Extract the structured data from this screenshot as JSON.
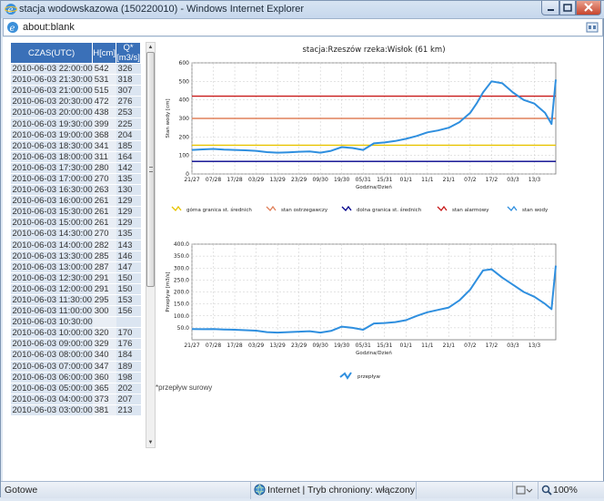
{
  "window": {
    "title": "stacja wodowskazowa (150220010) - Windows Internet Explorer"
  },
  "address": {
    "url": "about:blank"
  },
  "table": {
    "headers": [
      "CZAS(UTC)",
      "H[cm]",
      "Q*[m3/s]"
    ],
    "rows": [
      [
        "2010-06-03 22:00:00",
        "542",
        "326"
      ],
      [
        "2010-06-03 21:30:00",
        "531",
        "318"
      ],
      [
        "2010-06-03 21:00:00",
        "515",
        "307"
      ],
      [
        "2010-06-03 20:30:00",
        "472",
        "276"
      ],
      [
        "2010-06-03 20:00:00",
        "438",
        "253"
      ],
      [
        "2010-06-03 19:30:00",
        "399",
        "225"
      ],
      [
        "2010-06-03 19:00:00",
        "368",
        "204"
      ],
      [
        "2010-06-03 18:30:00",
        "341",
        "185"
      ],
      [
        "2010-06-03 18:00:00",
        "311",
        "164"
      ],
      [
        "2010-06-03 17:30:00",
        "280",
        "142"
      ],
      [
        "2010-06-03 17:00:00",
        "270",
        "135"
      ],
      [
        "2010-06-03 16:30:00",
        "263",
        "130"
      ],
      [
        "2010-06-03 16:00:00",
        "261",
        "129"
      ],
      [
        "2010-06-03 15:30:00",
        "261",
        "129"
      ],
      [
        "2010-06-03 15:00:00",
        "261",
        "129"
      ],
      [
        "2010-06-03 14:30:00",
        "270",
        "135"
      ],
      [
        "2010-06-03 14:00:00",
        "282",
        "143"
      ],
      [
        "2010-06-03 13:30:00",
        "285",
        "146"
      ],
      [
        "2010-06-03 13:00:00",
        "287",
        "147"
      ],
      [
        "2010-06-03 12:30:00",
        "291",
        "150"
      ],
      [
        "2010-06-03 12:00:00",
        "291",
        "150"
      ],
      [
        "2010-06-03 11:30:00",
        "295",
        "153"
      ],
      [
        "2010-06-03 11:00:00",
        "300",
        "156"
      ],
      [
        "2010-06-03 10:30:00",
        "",
        ""
      ],
      [
        "2010-06-03 10:00:00",
        "320",
        "170"
      ],
      [
        "2010-06-03 09:00:00",
        "329",
        "176"
      ],
      [
        "2010-06-03 08:00:00",
        "340",
        "184"
      ],
      [
        "2010-06-03 07:00:00",
        "347",
        "189"
      ],
      [
        "2010-06-03 06:00:00",
        "360",
        "198"
      ],
      [
        "2010-06-03 05:00:00",
        "365",
        "202"
      ],
      [
        "2010-06-03 04:00:00",
        "373",
        "207"
      ],
      [
        "2010-06-03 03:00:00",
        "381",
        "213"
      ]
    ]
  },
  "note": "*przepływ surowy",
  "status": {
    "text": "Gotowe",
    "zone": "Internet | Tryb chroniony: włączony",
    "zoom": "100%"
  },
  "colors": {
    "accent": "#3a70b8",
    "series": "#2f8fdf",
    "upper": "#e8c400",
    "warning": "#e0805a",
    "lower": "#00008b",
    "alarm": "#c81a1a"
  },
  "chart_data": [
    {
      "type": "line",
      "title": "stacja:Rzeszów   rzeka:Wisłok (61 km)",
      "xlabel": "Godzina/Dzień",
      "ylabel": "Stan wody [cm]",
      "ylim": [
        0,
        600
      ],
      "yticks": [
        "0",
        "100",
        "200",
        "300",
        "400",
        "500",
        "600"
      ],
      "xticks": [
        "21/27",
        "07/28",
        "17/28",
        "03/29",
        "13/29",
        "23/29",
        "09/30",
        "19/30",
        "05/31",
        "15/31",
        "01/1",
        "11/1",
        "21/1",
        "07/2",
        "17/2",
        "03/3",
        "13/3"
      ],
      "grid": true,
      "legend_position": "bottom",
      "legend": [
        "górna granica st. średnich",
        "stan ostrzegawczy",
        "dolna granica st. średnich",
        "stan alarmowy",
        "stan wody"
      ],
      "reference_lines": [
        {
          "name": "górna granica st. średnich",
          "value": 155,
          "color": "#e8c400"
        },
        {
          "name": "stan ostrzegawczy",
          "value": 300,
          "color": "#e0805a"
        },
        {
          "name": "dolna granica st. średnich",
          "value": 68,
          "color": "#00008b"
        },
        {
          "name": "stan alarmowy",
          "value": 420,
          "color": "#c81a1a"
        }
      ],
      "series": [
        {
          "name": "stan wody",
          "color": "#2f8fdf",
          "x": [
            0,
            0.5,
            1,
            1.5,
            2,
            2.5,
            3,
            3.5,
            4,
            4.5,
            5,
            5.5,
            6,
            6.5,
            7,
            7.5,
            8,
            8.5,
            9,
            9.5,
            10,
            10.5,
            11,
            11.5,
            12,
            12.5,
            13,
            13.3,
            13.6,
            14,
            14.5,
            15,
            15.5,
            16,
            16.5,
            16.8,
            17
          ],
          "y": [
            130,
            133,
            135,
            132,
            130,
            128,
            125,
            118,
            115,
            117,
            120,
            122,
            115,
            125,
            145,
            140,
            130,
            165,
            170,
            178,
            190,
            205,
            225,
            235,
            250,
            280,
            330,
            380,
            440,
            500,
            490,
            440,
            400,
            380,
            330,
            270,
            510
          ]
        }
      ]
    },
    {
      "type": "line",
      "xlabel": "Godzina/Dzień",
      "ylabel": "Przepływ [m3/s]",
      "ylim": [
        0,
        400
      ],
      "yticks": [
        "50.0",
        "100.0",
        "150.0",
        "200.0",
        "250.0",
        "300.0",
        "350.0",
        "400.0"
      ],
      "xticks": [
        "21/27",
        "07/28",
        "17/28",
        "03/29",
        "13/29",
        "23/29",
        "09/30",
        "19/30",
        "05/31",
        "15/31",
        "01/1",
        "11/1",
        "21/1",
        "07/2",
        "17/2",
        "03/3",
        "13/3"
      ],
      "grid": true,
      "legend_position": "bottom",
      "legend": [
        "przepływ"
      ],
      "series": [
        {
          "name": "przepływ",
          "color": "#2f8fdf",
          "x": [
            0,
            0.5,
            1,
            1.5,
            2,
            2.5,
            3,
            3.5,
            4,
            4.5,
            5,
            5.5,
            6,
            6.5,
            7,
            7.5,
            8,
            8.5,
            9,
            9.5,
            10,
            10.5,
            11,
            11.5,
            12,
            12.5,
            13,
            13.3,
            13.6,
            14,
            14.5,
            15,
            15.5,
            16,
            16.5,
            16.8,
            17
          ],
          "y": [
            45,
            44,
            45,
            43,
            42,
            40,
            38,
            32,
            30,
            32,
            34,
            36,
            30,
            37,
            55,
            50,
            42,
            68,
            70,
            74,
            82,
            100,
            115,
            125,
            135,
            165,
            210,
            250,
            290,
            295,
            260,
            230,
            200,
            180,
            150,
            128,
            310
          ]
        }
      ]
    }
  ]
}
